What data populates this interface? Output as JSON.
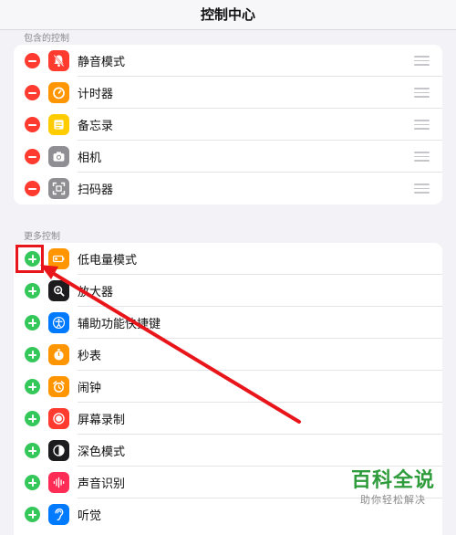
{
  "header": {
    "title": "控制中心"
  },
  "included": {
    "header": "包含的控制",
    "items": [
      {
        "label": "静音模式",
        "icon": "bell-slash-icon",
        "color": "#ff3b30"
      },
      {
        "label": "计时器",
        "icon": "timer-icon",
        "color": "#ff9500"
      },
      {
        "label": "备忘录",
        "icon": "notes-icon",
        "color": "#ffcc00"
      },
      {
        "label": "相机",
        "icon": "camera-icon",
        "color": "#8e8e93"
      },
      {
        "label": "扫码器",
        "icon": "qr-scan-icon",
        "color": "#8e8e93"
      }
    ]
  },
  "more": {
    "header": "更多控制",
    "items": [
      {
        "label": "低电量模式",
        "icon": "battery-icon",
        "color": "#ff9500"
      },
      {
        "label": "放大器",
        "icon": "magnifier-icon",
        "color": "#1c1c1e"
      },
      {
        "label": "辅助功能快捷键",
        "icon": "accessibility-icon",
        "color": "#007aff"
      },
      {
        "label": "秒表",
        "icon": "stopwatch-icon",
        "color": "#ff9500"
      },
      {
        "label": "闹钟",
        "icon": "alarm-icon",
        "color": "#ff9500"
      },
      {
        "label": "屏幕录制",
        "icon": "screen-record-icon",
        "color": "#ff3b30"
      },
      {
        "label": "深色模式",
        "icon": "dark-mode-icon",
        "color": "#1c1c1e"
      },
      {
        "label": "声音识别",
        "icon": "sound-recognition-icon",
        "color": "#ff2d55"
      },
      {
        "label": "听觉",
        "icon": "hearing-icon",
        "color": "#007aff"
      }
    ]
  },
  "annotation": {
    "color": "#e8161b"
  },
  "watermark": {
    "main": "百科全说",
    "sub": "助你轻松解决"
  }
}
